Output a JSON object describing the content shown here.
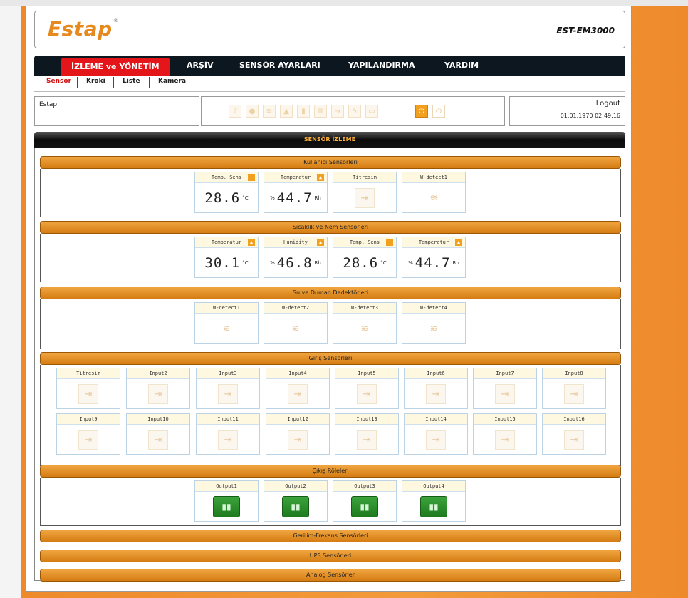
{
  "brand": {
    "logo": "Estap",
    "reg": "®",
    "model": "EST-EM3000"
  },
  "nav": {
    "items": [
      "İZLEME ve YÖNETİM",
      "ARŞİV",
      "SENSÖR AYARLARI",
      "YAPILANDIRMA",
      "YARDIM"
    ],
    "active": 0
  },
  "subnav": {
    "items": [
      "Sensor",
      "Kroki",
      "Liste",
      "Kamera"
    ],
    "active": 0
  },
  "info": {
    "site": "Estap",
    "logout": "Logout",
    "datetime": "01.01.1970 02:49:16",
    "status_icons": [
      "sound-icon",
      "drop-icon",
      "water-icon",
      "fire-icon",
      "door-icon",
      "heater-icon",
      "input-icon",
      "power-icon",
      "battery-icon"
    ],
    "plug_icons": [
      "plug-on-icon",
      "plug-off-icon"
    ]
  },
  "main_title": "SENSÖR İZLEME",
  "sections": [
    {
      "title": "Kullanıcı Sensörleri",
      "cards": [
        {
          "name": "Temp. Sens",
          "value": "28.6",
          "unit": "°C",
          "prefix": ""
        },
        {
          "name": "Temperatur",
          "value": "44.7",
          "unit": "Rh",
          "prefix": "%"
        },
        {
          "name": "Titresim",
          "icon": "input"
        },
        {
          "name": "W-detect1",
          "icon": "water"
        }
      ]
    },
    {
      "title": "Sıcaklık ve Nem Sensörleri",
      "cards": [
        {
          "name": "Temperatur",
          "value": "30.1",
          "unit": "°C",
          "prefix": ""
        },
        {
          "name": "Humidity",
          "value": "46.8",
          "unit": "Rh",
          "prefix": "%"
        },
        {
          "name": "Temp. Sens",
          "value": "28.6",
          "unit": "°C",
          "prefix": ""
        },
        {
          "name": "Temperatur",
          "value": "44.7",
          "unit": "Rh",
          "prefix": "%"
        }
      ]
    },
    {
      "title": "Su ve Duman Dedektörleri",
      "cards": [
        {
          "name": "W-detect1",
          "icon": "water"
        },
        {
          "name": "W-detect2",
          "icon": "water"
        },
        {
          "name": "W-detect3",
          "icon": "water"
        },
        {
          "name": "W-detect4",
          "icon": "water"
        }
      ]
    },
    {
      "title": "Giriş Sensörleri",
      "cards": [
        {
          "name": "Titresim"
        },
        {
          "name": "Input2"
        },
        {
          "name": "Input3"
        },
        {
          "name": "Input4"
        },
        {
          "name": "Input5"
        },
        {
          "name": "Input6"
        },
        {
          "name": "Input7"
        },
        {
          "name": "Input8"
        },
        {
          "name": "Input9"
        },
        {
          "name": "Input10"
        },
        {
          "name": "Input11"
        },
        {
          "name": "Input12"
        },
        {
          "name": "Input13"
        },
        {
          "name": "Input14"
        },
        {
          "name": "Input15"
        },
        {
          "name": "Input16"
        }
      ]
    },
    {
      "title": "Çıkış Röleleri",
      "cards": [
        {
          "name": "Output1"
        },
        {
          "name": "Output2"
        },
        {
          "name": "Output3"
        },
        {
          "name": "Output4"
        }
      ]
    },
    {
      "title": "Gerilim-Frekans Sensörleri"
    },
    {
      "title": "UPS Sensörleri"
    },
    {
      "title": "Analog Sensörler"
    }
  ]
}
